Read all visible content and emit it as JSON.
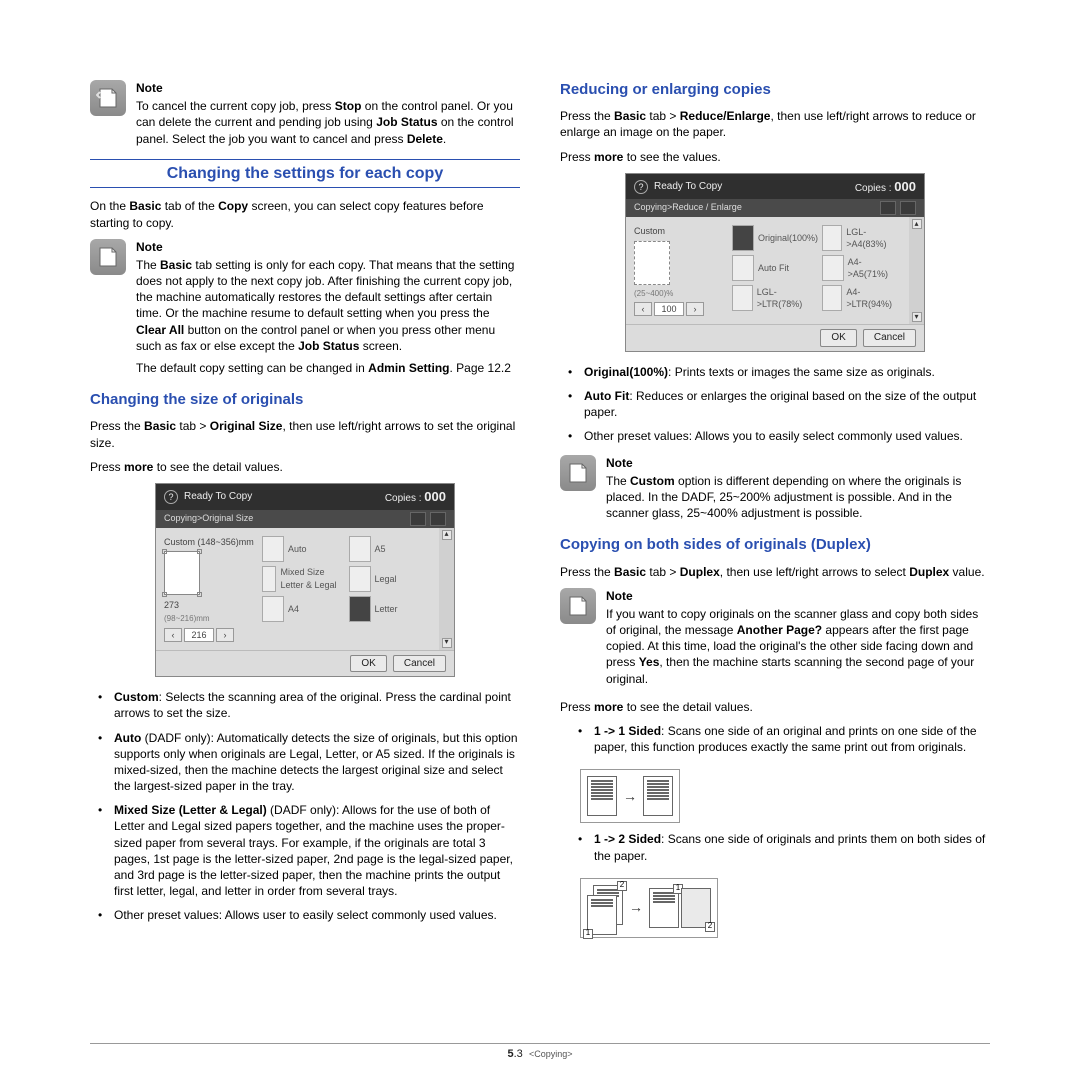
{
  "col1": {
    "note1": {
      "title": "Note",
      "text_before_stop": "To cancel the current copy job, press ",
      "stop": "Stop",
      "text_mid1": " on the control panel. Or you can delete the current and pending job using ",
      "jobstatus": "Job Status",
      "text_mid2": " on the control panel. Select the job you want to cancel and press ",
      "delete": "Delete",
      "text_end": "."
    },
    "heading1": "Changing the settings for each copy",
    "intro1_a": "On the ",
    "intro1_b": "Basic",
    "intro1_c": " tab of the ",
    "intro1_d": "Copy",
    "intro1_e": " screen, you can select copy features before starting to copy.",
    "note2": {
      "title": "Note",
      "t1": "The ",
      "b1": "Basic",
      "t2": " tab setting is only for each copy. That means that the setting does not apply to the next copy job. After finishing the current copy job, the machine automatically restores the default settings after certain time. Or the machine resume to default setting when you press the ",
      "b2": "Clear All",
      "t3": " button on the control panel or when you press other menu such as fax or else except the ",
      "b3": "Job Status",
      "t4": " screen.",
      "p2a": "The default copy setting can be changed in ",
      "p2b": "Admin Setting",
      "p2c": ". Page 12.2"
    },
    "subhead1": "Changing the size of originals",
    "p3a": "Press the ",
    "p3b": "Basic",
    "p3c": " tab > ",
    "p3d": "Original Size",
    "p3e": ", then use left/right arrows to set the original size.",
    "p4a": "Press ",
    "p4b": "more",
    "p4c": " to see the detail values.",
    "shot1": {
      "ready": "Ready To Copy",
      "copies_lbl": "Copies :",
      "copies_val": "000",
      "crumb": "Copying>Original Size",
      "side_lbl": "Custom (148~356)mm",
      "side_mid": "273",
      "side_slim": "(98~216)mm",
      "step_val": "216",
      "cells": [
        "Auto",
        "A5",
        "Mixed Size Letter & Legal",
        "Legal",
        "A4",
        "Letter"
      ],
      "ok": "OK",
      "cancel": "Cancel"
    },
    "bullets1": [
      {
        "b": "Custom",
        "t": ": Selects the scanning area of the original. Press the cardinal point arrows to set the size."
      },
      {
        "b": "Auto",
        "t": " (DADF only): Automatically detects the size of originals, but this option supports only when originals are Legal, Letter, or A5 sized. If the originals is mixed-sized, then the machine detects the largest original size and select the largest-sized paper in the tray."
      },
      {
        "b": "Mixed Size (Letter & Legal)",
        "t": " (DADF only): Allows for the use of both of Letter and Legal sized papers together, and the machine uses the proper-sized paper from several trays. For example, if the originals are total 3 pages, 1st page is the letter-sized paper, 2nd page is the legal-sized paper, and 3rd page is the letter-sized paper, then the machine prints the output first letter, legal, and letter in order from several trays."
      },
      {
        "b": "",
        "t": "Other preset values: Allows user to easily select commonly used values."
      }
    ]
  },
  "col2": {
    "subhead1": "Reducing or enlarging copies",
    "p1a": "Press the ",
    "p1b": "Basic",
    "p1c": " tab > ",
    "p1d": "Reduce/Enlarge",
    "p1e": ", then use left/right arrows to reduce or enlarge an image on the paper.",
    "p2a": "Press ",
    "p2b": "more",
    "p2c": " to see the values.",
    "shot2": {
      "ready": "Ready To Copy",
      "copies_lbl": "Copies :",
      "copies_val": "000",
      "crumb": "Copying>Reduce / Enlarge",
      "side_lbl": "Custom",
      "side_slim": "(25~400)%",
      "step_val": "100",
      "cells": [
        "Original(100%)",
        "LGL->A4(83%)",
        "Auto Fit",
        "A4->A5(71%)",
        "LGL->LTR(78%)",
        "A4->LTR(94%)"
      ],
      "ok": "OK",
      "cancel": "Cancel"
    },
    "bullets2": [
      {
        "b": "Original(100%)",
        "t": ": Prints texts or images the same size as originals."
      },
      {
        "b": "Auto Fit",
        "t": ": Reduces or enlarges the original based on the size of the output paper."
      },
      {
        "b": "",
        "t": "Other preset values: Allows you to easily select commonly used values."
      }
    ],
    "note3": {
      "title": "Note",
      "t1": "The ",
      "b1": "Custom",
      "t2": " option is different depending on where the originals is placed. In the DADF, 25~200% adjustment is possible. And in the scanner glass, 25~400% adjustment is possible."
    },
    "subhead2": "Copying on both sides of originals (Duplex)",
    "p3a": "Press the ",
    "p3b": "Basic",
    "p3c": " tab > ",
    "p3d": "Duplex",
    "p3e": ", then use left/right arrows to select ",
    "p3f": "Duplex",
    "p3g": " value.",
    "note4": {
      "title": "Note",
      "t1": "If you want to copy originals on the scanner glass and copy both sides of original, the message ",
      "b1": "Another Page?",
      "t2": " appears after the first page copied. At this time, load the original's the other side facing down and press ",
      "b2": "Yes",
      "t3": ", then the machine starts scanning the second page of your original."
    },
    "p4a": "Press ",
    "p4b": "more",
    "p4c": " to see the detail values.",
    "sub1": {
      "b": "1 -> 1 Sided",
      "t": ": Scans one side of an original and prints on one side of the paper, this function produces exactly the same print out from originals."
    },
    "sub2": {
      "b": "1 -> 2 Sided",
      "t": ": Scans one side of originals and prints them on both sides of the paper."
    }
  },
  "footer": {
    "chapnum": "5",
    "page": ".3",
    "name": "<Copying>"
  }
}
